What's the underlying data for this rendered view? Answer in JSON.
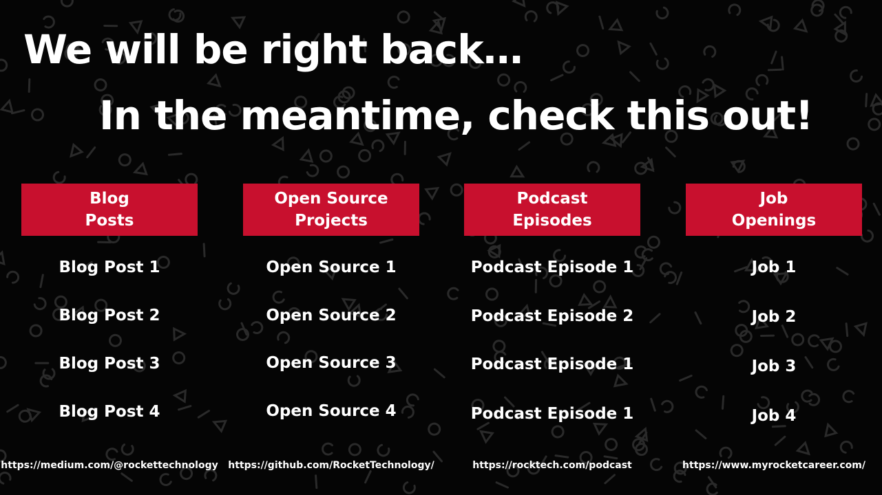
{
  "headline": {
    "line1": "We will be right back…",
    "line2": "In the meantime, check this out!"
  },
  "colors": {
    "background": "#050505",
    "accent": "#c8102e",
    "pattern": "#2a2a2a",
    "text": "#ffffff"
  },
  "columns": [
    {
      "title": "Blog\nPosts",
      "items": [
        "Blog Post 1",
        "Blog Post 2",
        "Blog Post 3",
        "Blog Post 4"
      ],
      "link": "https://medium.com/@rockettechnology"
    },
    {
      "title": "Open Source\nProjects",
      "items": [
        "Open Source 1",
        "Open Source 2",
        "Open Source 3",
        "Open Source 4"
      ],
      "link": "https://github.com/RocketTechnology/"
    },
    {
      "title": "Podcast\nEpisodes",
      "items": [
        "Podcast Episode 1",
        "Podcast Episode 2",
        "Podcast Episode 1",
        "Podcast Episode 1"
      ],
      "link": "https://rocktech.com/podcast"
    },
    {
      "title": "Job\nOpenings",
      "items": [
        "Job 1",
        "Job 2",
        "Job 3",
        "Job 4"
      ],
      "link": "https://www.myrocketcareer.com/"
    }
  ]
}
